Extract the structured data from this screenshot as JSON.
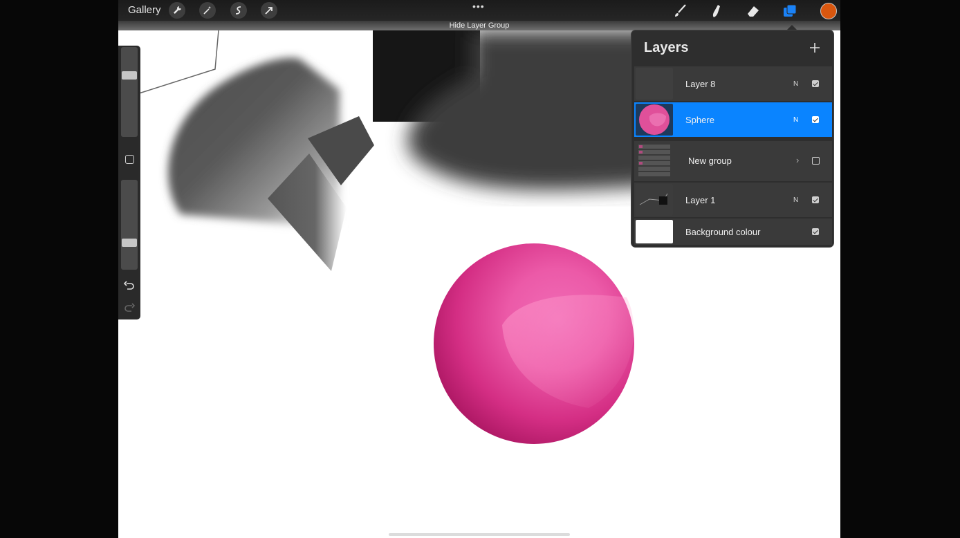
{
  "topbar": {
    "gallery_label": "Gallery",
    "tools_left": [
      "wrench-icon",
      "magic-wand-icon",
      "selection-icon",
      "transform-arrow-icon"
    ],
    "more_label": "•••",
    "hide_layer_group_label": "Hide Layer Group",
    "tools_right": [
      "brush-icon",
      "smudge-icon",
      "eraser-icon",
      "layers-icon"
    ],
    "current_color": "#d9570f",
    "active_tool_color": "#1a82f7"
  },
  "sidebar": {
    "brush_size": 0.7,
    "opacity": 0.28
  },
  "layers_panel": {
    "title": "Layers",
    "layers": [
      {
        "name": "Layer 8",
        "blend": "N",
        "visible": true,
        "selected": false
      },
      {
        "name": "Sphere",
        "blend": "N",
        "visible": true,
        "selected": true
      },
      {
        "name": "New group",
        "blend": "",
        "visible": false,
        "selected": false,
        "is_group": true
      },
      {
        "name": "Layer 1",
        "blend": "N",
        "visible": true,
        "selected": false
      },
      {
        "name": "Background colour",
        "blend": "",
        "visible": true,
        "selected": false
      }
    ]
  },
  "colors": {
    "selection_blue": "#0a84ff",
    "sphere_pink": "#e0509a"
  }
}
